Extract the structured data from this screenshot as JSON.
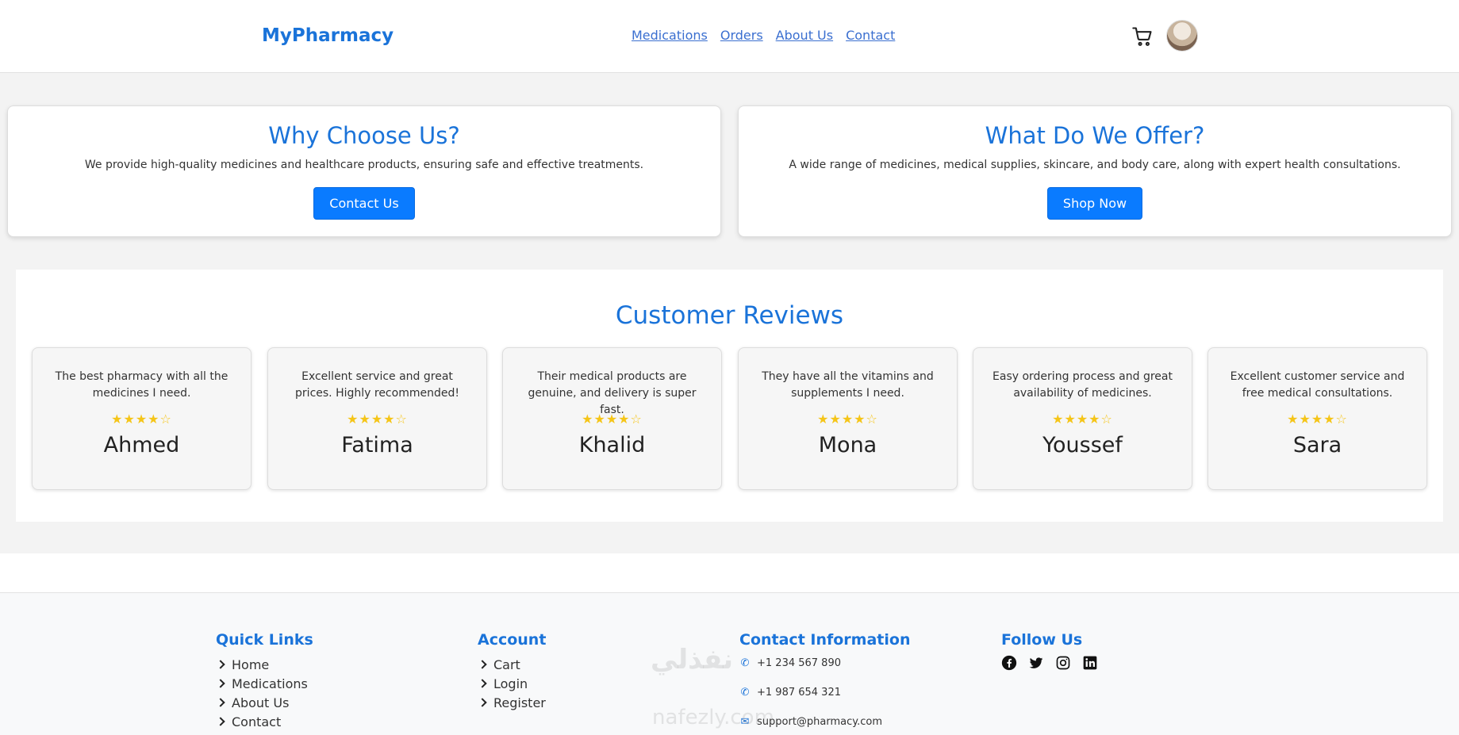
{
  "header": {
    "logo": "MyPharmacy",
    "nav": [
      "Medications",
      "Orders",
      "About Us",
      "Contact"
    ]
  },
  "features": [
    {
      "title": "Why Choose Us?",
      "text": "We provide high-quality medicines and healthcare products, ensuring safe and effective treatments.",
      "button": "Contact Us"
    },
    {
      "title": "What Do We Offer?",
      "text": "A wide range of medicines, medical supplies, skincare, and body care, along with expert health consultations.",
      "button": "Shop Now"
    }
  ],
  "reviews": {
    "title": "Customer Reviews",
    "items": [
      {
        "text": "The best pharmacy with all the medicines I need.",
        "stars": "★★★★☆",
        "rating": 4,
        "name": "Ahmed"
      },
      {
        "text": "Excellent service and great prices. Highly recommended!",
        "stars": "★★★★☆",
        "rating": 4,
        "name": "Fatima"
      },
      {
        "text": "Their medical products are genuine, and delivery is super fast.",
        "stars": "★★★★☆",
        "rating": 4,
        "name": "Khalid"
      },
      {
        "text": "They have all the vitamins and supplements I need.",
        "stars": "★★★★☆",
        "rating": 4,
        "name": "Mona"
      },
      {
        "text": "Easy ordering process and great availability of medicines.",
        "stars": "★★★★☆",
        "rating": 4,
        "name": "Youssef"
      },
      {
        "text": "Excellent customer service and free medical consultations.",
        "stars": "★★★★☆",
        "rating": 4,
        "name": "Sara"
      }
    ]
  },
  "footer": {
    "quick_links": {
      "title": "Quick Links",
      "items": [
        "Home",
        "Medications",
        "About Us",
        "Contact"
      ]
    },
    "account": {
      "title": "Account",
      "items": [
        "Cart",
        "Login",
        "Register"
      ]
    },
    "contact": {
      "title": "Contact Information",
      "phone1": "+1 234 567 890",
      "phone2": "+1 987 654 321",
      "email": "support@pharmacy.com"
    },
    "follow": {
      "title": "Follow Us",
      "icons": [
        "facebook-icon",
        "twitter-icon",
        "instagram-icon",
        "linkedin-icon"
      ]
    }
  },
  "watermark": {
    "arabic": "نفذلي",
    "latin": "nafezly.com"
  },
  "colors": {
    "accent": "#1a73d9",
    "button": "#0a7bff",
    "star": "#f5c518"
  }
}
